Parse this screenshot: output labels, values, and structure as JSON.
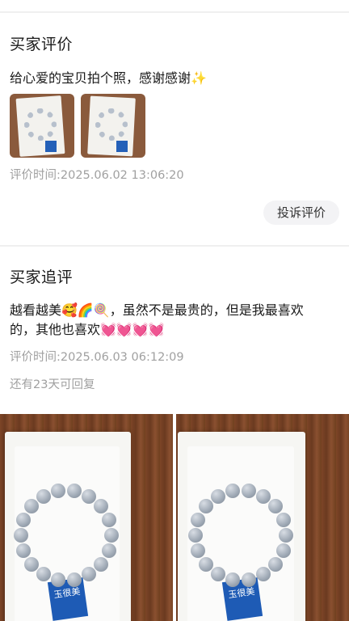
{
  "review": {
    "title": "买家评价",
    "text": "给心爱的宝贝拍个照，感谢感谢✨",
    "time": "评价时间:2025.06.02 13:06:20",
    "report_label": "投诉评价"
  },
  "followup": {
    "title": "买家追评",
    "text_line1": "越看越美🥰🌈🍭，虽然不是最贵的，但是我最喜欢",
    "text_line2": "的，其他也喜欢💓💓💓💓",
    "time": "评价时间:2025.06.03 06:12:09",
    "reply_remaining": "还有23天可回复"
  },
  "photos": {
    "card_text": "玉很美"
  }
}
